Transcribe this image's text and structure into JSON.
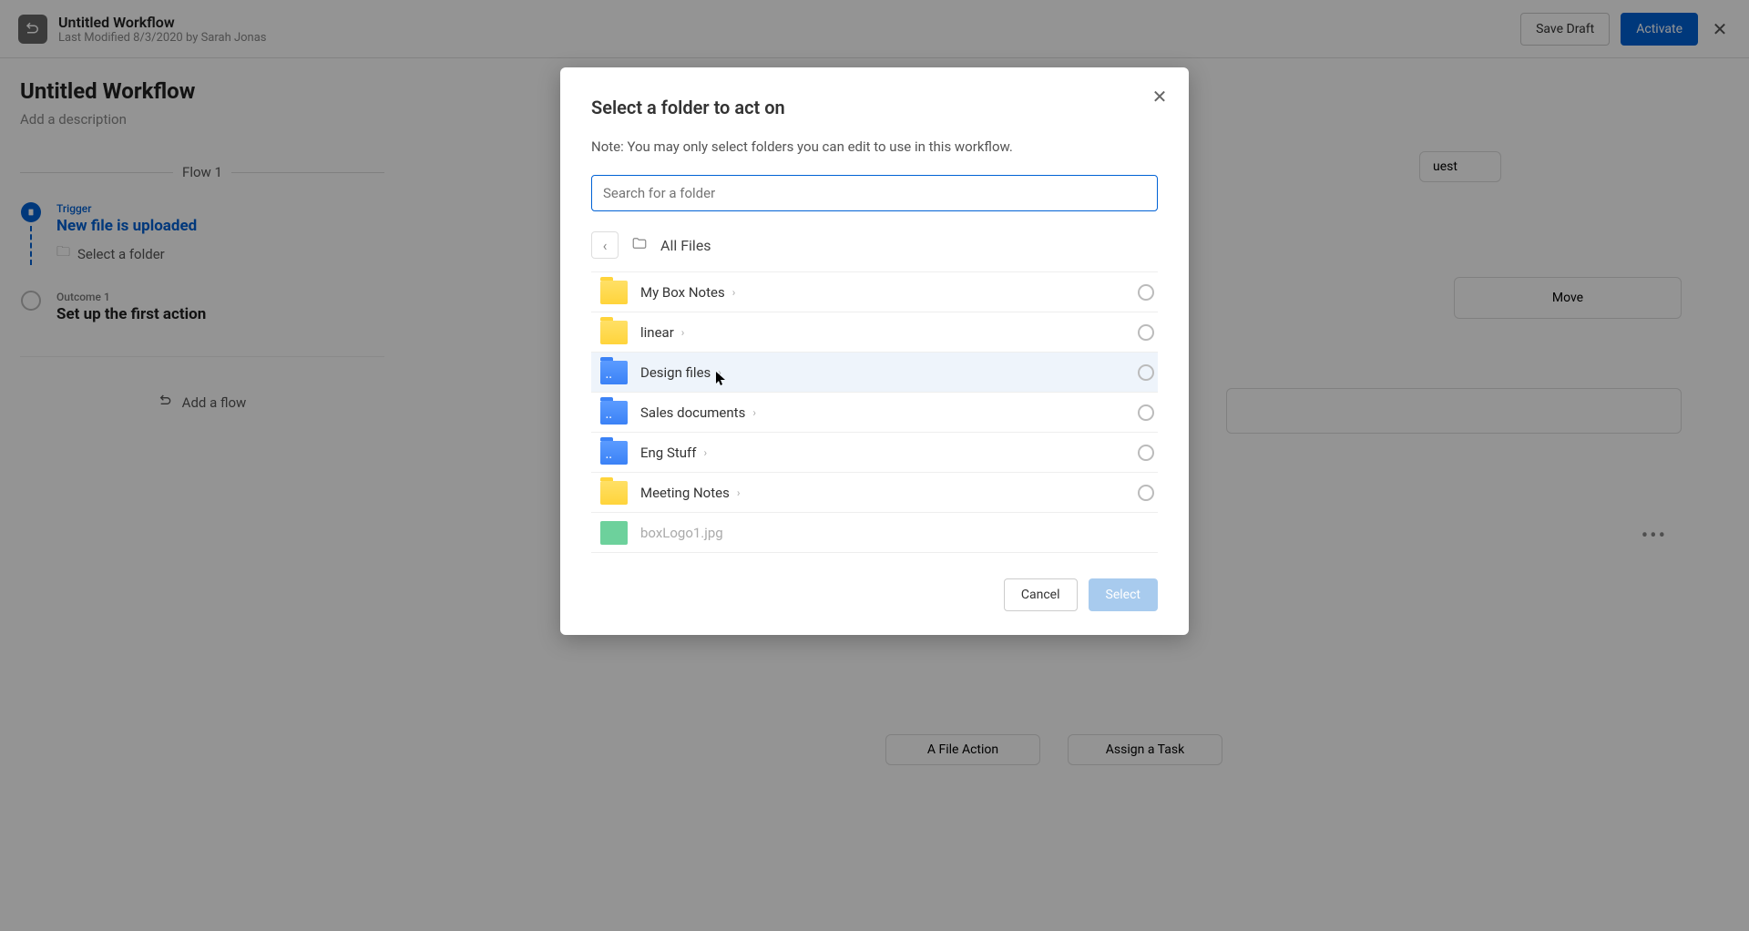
{
  "header": {
    "title": "Untitled Workflow",
    "subtitle": "Last Modified 8/3/2020 by Sarah Jonas",
    "save_draft": "Save Draft",
    "activate": "Activate"
  },
  "page": {
    "title": "Untitled Workflow",
    "description_placeholder": "Add a description",
    "flow_label": "Flow 1",
    "add_flow": "Add a flow"
  },
  "trigger": {
    "label": "Trigger",
    "title": "New file is uploaded",
    "select_folder": "Select a folder"
  },
  "outcome": {
    "label": "Outcome 1",
    "title": "Set up the first action"
  },
  "bg_cards": {
    "quest": "uest",
    "move": "Move",
    "file_action": "A File Action",
    "assign_task": "Assign a Task"
  },
  "modal": {
    "title": "Select a folder to act on",
    "note": "Note: You may only select folders you can edit to use in this workflow.",
    "search_placeholder": "Search for a folder",
    "breadcrumb": "All Files",
    "cancel": "Cancel",
    "select": "Select",
    "items": [
      {
        "name": "My Box Notes",
        "icon": "yellow",
        "selectable": true,
        "expandable": true
      },
      {
        "name": "linear",
        "icon": "yellow",
        "selectable": true,
        "expandable": true
      },
      {
        "name": "Design files",
        "icon": "blue",
        "selectable": true,
        "expandable": true,
        "hover": true
      },
      {
        "name": "Sales documents",
        "icon": "blue",
        "selectable": true,
        "expandable": true
      },
      {
        "name": "Eng Stuff",
        "icon": "blue",
        "selectable": true,
        "expandable": true
      },
      {
        "name": "Meeting Notes",
        "icon": "yellow",
        "selectable": true,
        "expandable": true
      },
      {
        "name": "boxLogo1.jpg",
        "icon": "img",
        "selectable": false,
        "expandable": false
      }
    ]
  }
}
